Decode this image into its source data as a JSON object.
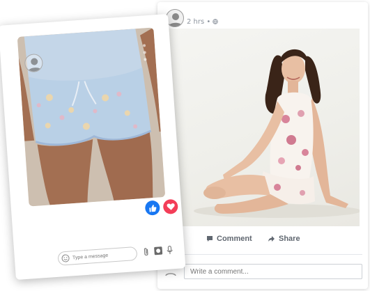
{
  "feed_post": {
    "timestamp": "2 hrs",
    "separator": " • ",
    "privacy_icon": "globe-icon",
    "photo_description_icon": "photo",
    "actions": {
      "comment_label": "Comment",
      "share_label": "Share"
    },
    "comment_placeholder": "Write a comment..."
  },
  "story": {
    "reactions": {
      "like_icon": "thumbs-up-icon",
      "love_icon": "heart-icon",
      "like_color": "#1877f2",
      "love_color": "#f33e58"
    },
    "message_placeholder": "Type a message",
    "tools": [
      "attachment-icon",
      "camera-icon",
      "microphone-icon"
    ]
  },
  "colors": {
    "card_background": "#ffffff",
    "muted_text": "#8d949e",
    "action_text": "#606770"
  }
}
